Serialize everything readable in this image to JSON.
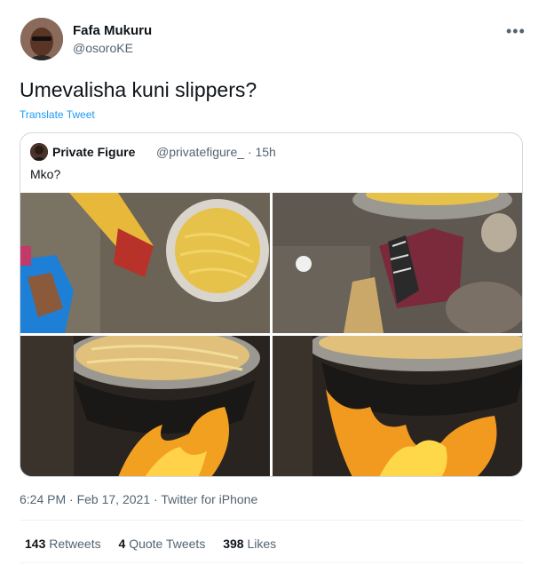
{
  "tweet": {
    "author_name": "Fafa Mukuru",
    "author_handle": "@osoroKE",
    "more_icon": "more-dots-icon",
    "text": "Umevalisha kuni slippers?",
    "translate_label": "Translate Tweet",
    "time": "6:24 PM",
    "date": "Feb 17, 2021",
    "source": "Twitter for iPhone",
    "sep": " · "
  },
  "quote": {
    "author_name": "Private Figure",
    "author_handle": "@privatefigure_",
    "time_ago": "· 15h",
    "text": "Mko?"
  },
  "stats": {
    "retweets_count": "143",
    "retweets_label": "Retweets",
    "quotes_count": "4",
    "quotes_label": "Quote Tweets",
    "likes_count": "398",
    "likes_label": "Likes"
  },
  "colors": {
    "link": "#1d9bf0",
    "secondary": "#536471",
    "border": "#cfd9de"
  }
}
